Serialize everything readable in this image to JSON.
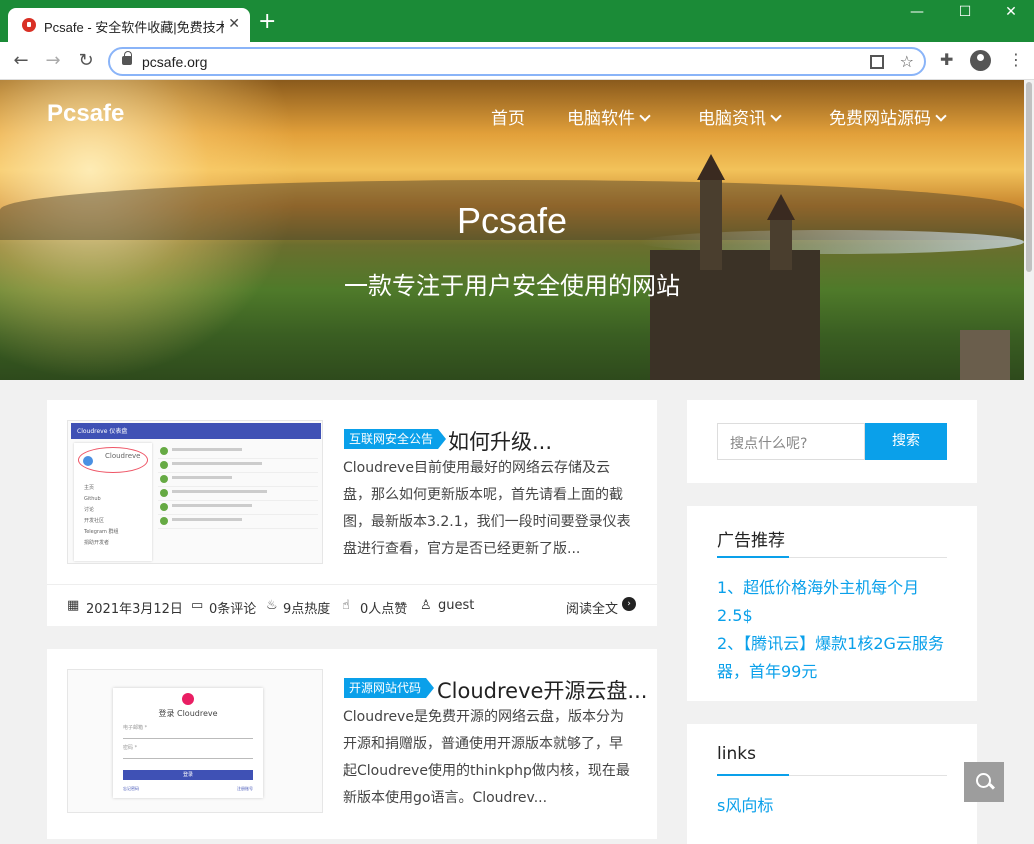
{
  "browser": {
    "tab_title": "Pcsafe - 安全软件收藏|免费技术",
    "tab_close": "✕",
    "new_tab": "+",
    "url": "pcsafe.org",
    "window_controls": {
      "minimize": "—",
      "maximize": "☐",
      "close": "✕"
    }
  },
  "site": {
    "logo": "Pcsafe",
    "nav": [
      {
        "label": "首页",
        "dropdown": false
      },
      {
        "label": "电脑软件",
        "dropdown": true
      },
      {
        "label": "电脑资讯",
        "dropdown": true
      },
      {
        "label": "免费网站源码",
        "dropdown": true
      }
    ],
    "hero_title": "Pcsafe",
    "hero_subtitle": "一款专注于用户安全使用的网站"
  },
  "posts": [
    {
      "category": "互联网安全公告",
      "title": "如何升级...",
      "excerpt": "Cloudreve目前使用最好的网络云存储及云盘，那么如何更新版本呢，首先请看上面的截图，最新版本3.2.1，我们一段时间要登录仪表盘进行查看，官方是否已经更新了版...",
      "date": "2021年3月12日",
      "comments": "0条评论",
      "views": "9点热度",
      "likes": "0人点赞",
      "author": "guest",
      "read_more": "阅读全文"
    },
    {
      "category": "开源网站代码",
      "title": "Cloudreve开源云盘...",
      "excerpt": "Cloudreve是免费开源的网络云盘，版本分为开源和捐赠版，普通使用开源版本就够了，早起Cloudreve使用的thinkphp做内核，现在最新版本使用go语言。Cloudrev..."
    }
  ],
  "thumb1": {
    "header": "Cloudreve 仪表盘",
    "brand": "Cloudreve",
    "menu": [
      "主页",
      "Github",
      "讨论",
      "开发社区",
      "Telegram 群组",
      "捐助开发者"
    ]
  },
  "thumb2": {
    "heading": "登录 Cloudreve",
    "email_label": "电子邮箱 *",
    "password_label": "密码 *",
    "login": "登录",
    "forgot": "忘记密码",
    "register": "注册账号"
  },
  "sidebar": {
    "search_placeholder": "搜点什么呢?",
    "search_button": "搜索",
    "ads_title": "广告推荐",
    "ads": [
      "1、超低价格海外主机每个月2.5$",
      "2、【腾讯云】爆款1核2G云服务器，首年99元"
    ],
    "links_title": "links",
    "links": [
      "s风向标"
    ]
  },
  "colors": {
    "accent": "#0aa0ea",
    "browser_frame": "#1b8b37"
  }
}
